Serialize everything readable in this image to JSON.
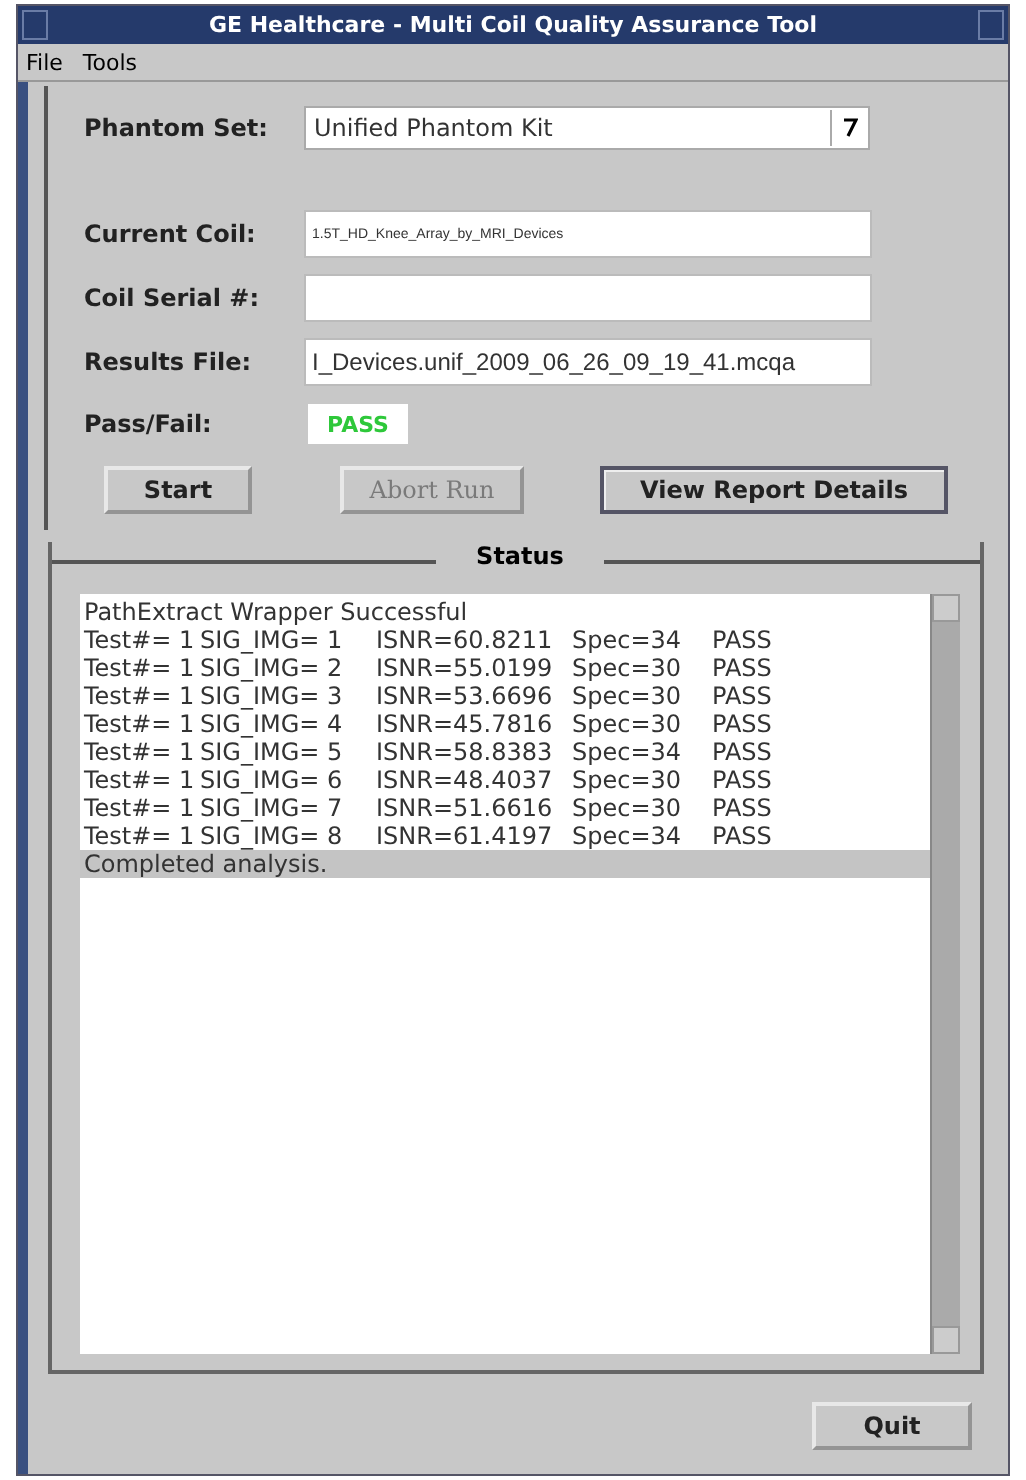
{
  "window": {
    "title": "GE Healthcare - Multi Coil Quality Assurance Tool"
  },
  "menu": [
    "File",
    "Tools"
  ],
  "form": {
    "phantom_set": {
      "label": "Phantom Set:",
      "value": "Unified Phantom Kit"
    },
    "fields": [
      {
        "label": "Current Coil:",
        "value": "1.5T_HD_Knee_Array_by_MRI_Devices",
        "kind": "small"
      },
      {
        "label": "Coil Serial #:",
        "kind": "normal"
      },
      {
        "label": "Results File:",
        "value": "I_Devices.unif_2009_06_26_09_19_41.mcqa",
        "kind": "normal"
      }
    ],
    "pass_fail": {
      "label": "Pass/Fail:",
      "value": "PASS"
    }
  },
  "buttons": [
    {
      "label": "Start",
      "disabled": false,
      "default": false
    },
    {
      "label": "Abort Run",
      "disabled": true,
      "default": false
    },
    {
      "label": "View Report Details",
      "disabled": false,
      "default": true
    }
  ],
  "status": {
    "title": "Status",
    "lines": [
      {
        "text": "PathExtract Wrapper Successful",
        "selected": false
      },
      {
        "cols": [
          "Test#= 1",
          "SIG_IMG= 1",
          "ISNR=60.8211",
          "Spec=34",
          "PASS"
        ],
        "selected": false
      },
      {
        "cols": [
          "Test#= 1",
          "SIG_IMG= 2",
          "ISNR=55.0199",
          "Spec=30",
          "PASS"
        ],
        "selected": false
      },
      {
        "cols": [
          "Test#= 1",
          "SIG_IMG= 3",
          "ISNR=53.6696",
          "Spec=30",
          "PASS"
        ],
        "selected": false
      },
      {
        "cols": [
          "Test#= 1",
          "SIG_IMG= 4",
          "ISNR=45.7816",
          "Spec=30",
          "PASS"
        ],
        "selected": false
      },
      {
        "cols": [
          "Test#= 1",
          "SIG_IMG= 5",
          "ISNR=58.8383",
          "Spec=34",
          "PASS"
        ],
        "selected": false
      },
      {
        "cols": [
          "Test#= 1",
          "SIG_IMG= 6",
          "ISNR=48.4037",
          "Spec=30",
          "PASS"
        ],
        "selected": false
      },
      {
        "cols": [
          "Test#= 1",
          "SIG_IMG= 7",
          "ISNR=51.6616",
          "Spec=30",
          "PASS"
        ],
        "selected": false
      },
      {
        "cols": [
          "Test#= 1",
          "SIG_IMG= 8",
          "ISNR=61.4197",
          "Spec=34",
          "PASS"
        ],
        "selected": false
      },
      {
        "text": "Completed analysis.",
        "selected": true
      }
    ]
  },
  "quit": "Quit"
}
